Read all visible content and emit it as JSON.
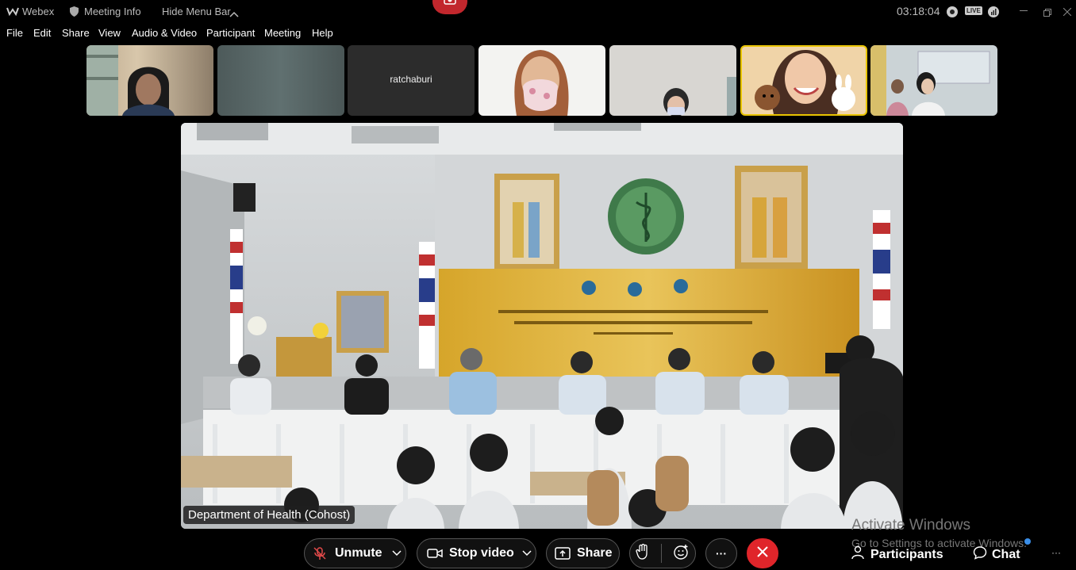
{
  "titlebar": {
    "app_name": "Webex",
    "meeting_info": "Meeting Info",
    "hide_menu_bar": "Hide Menu Bar",
    "clock": "03:18:04",
    "live_badge": "LIVE"
  },
  "menu": {
    "items": [
      {
        "label": "File"
      },
      {
        "label": "Edit"
      },
      {
        "label": "Share"
      },
      {
        "label": "View"
      },
      {
        "label": "Audio & Video"
      },
      {
        "label": "Participant"
      },
      {
        "label": "Meeting"
      },
      {
        "label": "Help"
      }
    ]
  },
  "thumbnails": [
    {
      "label": ""
    },
    {
      "label": ""
    },
    {
      "label": "ratchaburi"
    },
    {
      "label": ""
    },
    {
      "label": ""
    },
    {
      "label": ""
    },
    {
      "label": ""
    }
  ],
  "main_video": {
    "speaker_name": "Department of Health (Cohost)"
  },
  "controls": {
    "unmute": "Unmute",
    "stop_video": "Stop video",
    "share": "Share",
    "more": "···",
    "participants": "Participants",
    "chat": "Chat",
    "overflow": "···"
  },
  "watermark": {
    "line1": "Activate Windows",
    "line2": "Go to Settings to activate Windows."
  },
  "colors": {
    "end_call": "#e0252a",
    "background": "#000000"
  }
}
